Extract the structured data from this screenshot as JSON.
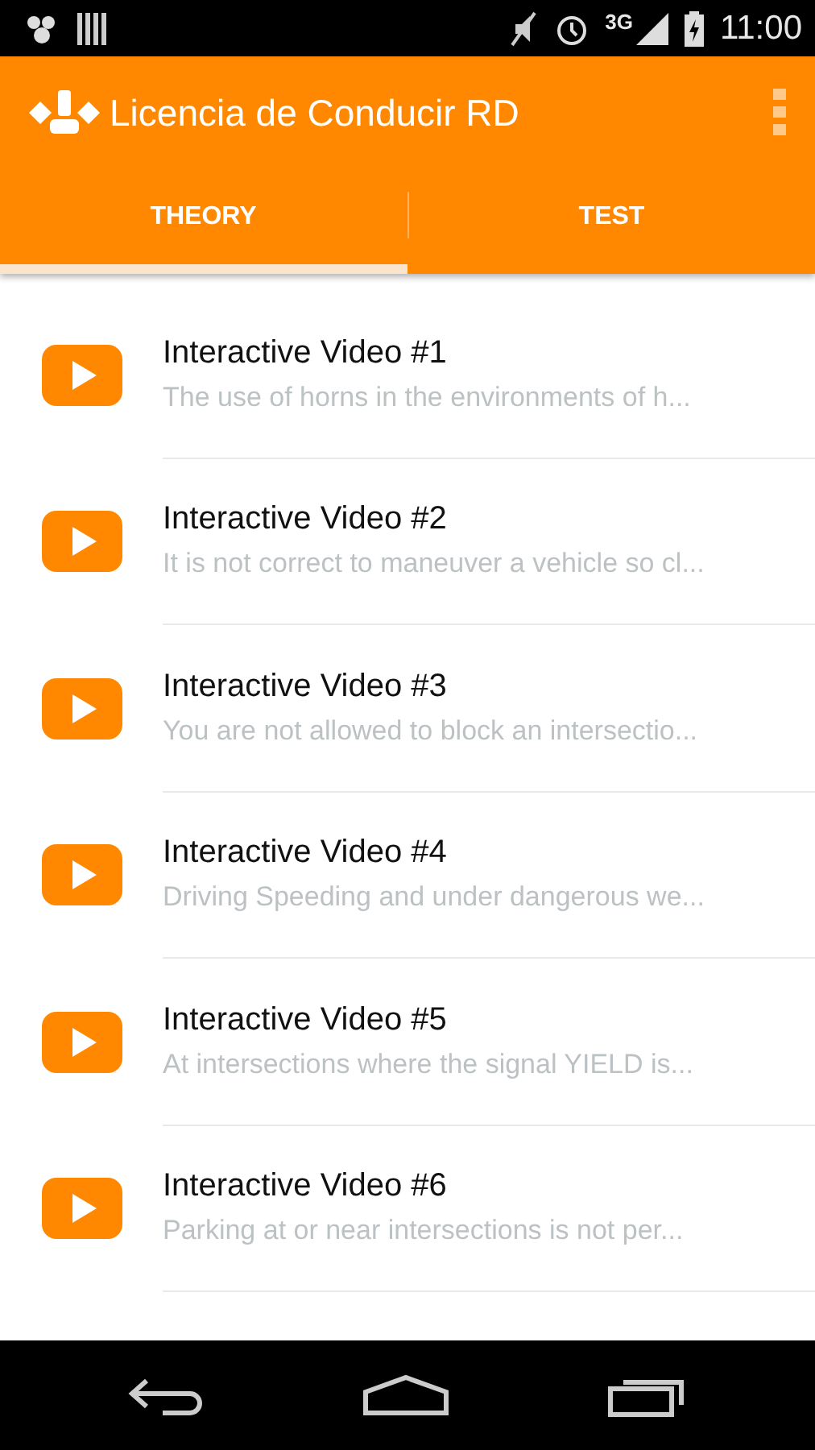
{
  "status_bar": {
    "network": "3G",
    "time": "11:00"
  },
  "app_bar": {
    "title": "Licencia de Conducir RD"
  },
  "tabs": [
    {
      "label": "THEORY",
      "selected": true
    },
    {
      "label": "TEST",
      "selected": false
    }
  ],
  "items": [
    {
      "title": "Interactive Video #1",
      "subtitle": "The use of horns in the environments of h..."
    },
    {
      "title": "Interactive Video #2",
      "subtitle": "It is not correct to maneuver a vehicle so cl..."
    },
    {
      "title": "Interactive Video #3",
      "subtitle": "You are not allowed to block an intersectio..."
    },
    {
      "title": "Interactive Video #4",
      "subtitle": "Driving Speeding and under dangerous we..."
    },
    {
      "title": "Interactive Video #5",
      "subtitle": "At intersections where the signal YIELD is..."
    },
    {
      "title": "Interactive Video #6",
      "subtitle": "Parking at or near intersections is not per..."
    }
  ]
}
